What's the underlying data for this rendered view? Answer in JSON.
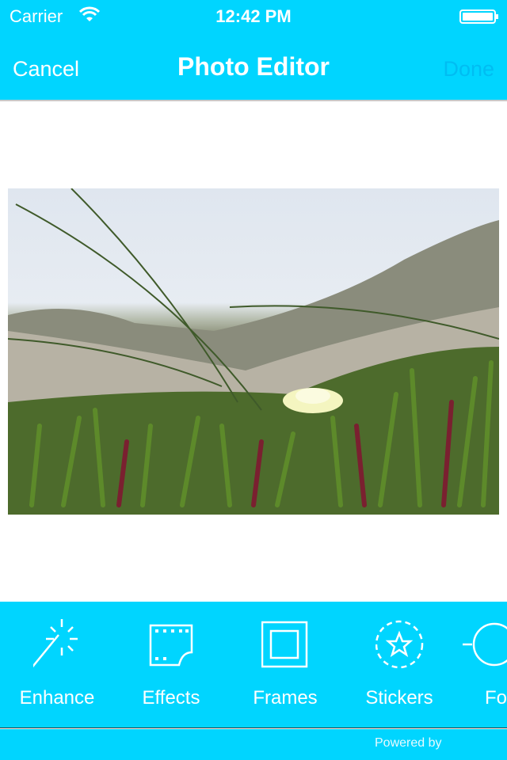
{
  "status_bar": {
    "carrier": "Carrier",
    "time": "12:42 PM",
    "battery_level": 1.0
  },
  "nav": {
    "cancel": "Cancel",
    "title": "Photo Editor",
    "done": "Done"
  },
  "colors": {
    "accent": "#00d5ff",
    "done_disabled": "#00bdf2"
  },
  "tools": [
    {
      "label": "Enhance",
      "icon": "magic-wand-icon"
    },
    {
      "label": "Effects",
      "icon": "film-icon"
    },
    {
      "label": "Frames",
      "icon": "frame-icon"
    },
    {
      "label": "Stickers",
      "icon": "star-sticker-icon"
    },
    {
      "label": "Fo",
      "icon": "focus-icon"
    }
  ],
  "footer": {
    "powered_by": "Powered by"
  }
}
